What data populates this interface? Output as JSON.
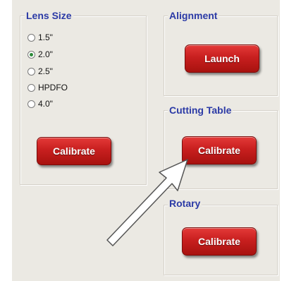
{
  "lens_size": {
    "title": "Lens Size",
    "options": [
      {
        "label": "1.5\"",
        "checked": false
      },
      {
        "label": "2.0\"",
        "checked": true
      },
      {
        "label": "2.5\"",
        "checked": false
      },
      {
        "label": "HPDFO",
        "checked": false
      },
      {
        "label": "4.0\"",
        "checked": false
      }
    ],
    "calibrate_label": "Calibrate"
  },
  "alignment": {
    "title": "Alignment",
    "launch_label": "Launch"
  },
  "cutting_table": {
    "title": "Cutting Table",
    "calibrate_label": "Calibrate"
  },
  "rotary": {
    "title": "Rotary",
    "calibrate_label": "Calibrate"
  },
  "colors": {
    "title_blue": "#2b3aa6",
    "button_red": "#c81f1f",
    "panel_bg": "#ebe9e3",
    "radio_selected": "#2d8a3a"
  },
  "annotation": {
    "icon": "pointer-arrow-icon"
  }
}
